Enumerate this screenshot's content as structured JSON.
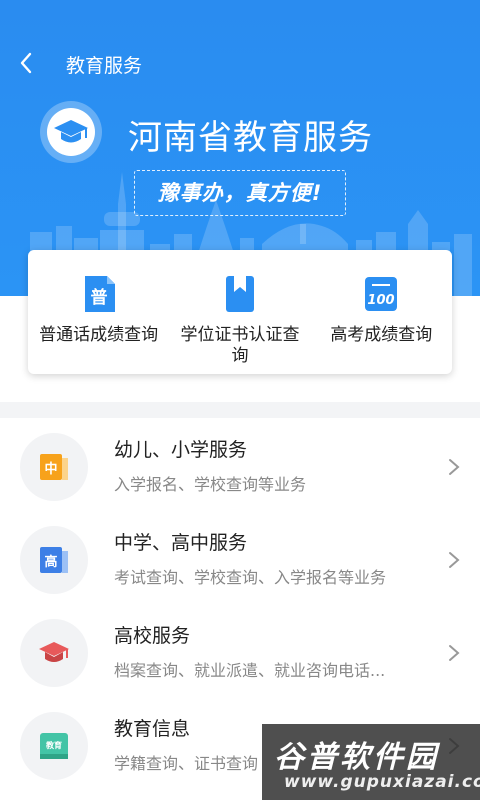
{
  "header": {
    "nav_title": "教育服务",
    "hero_title": "河南省教育服务",
    "slogan": "豫事办，真方便!"
  },
  "quick_links": [
    {
      "label": "普通话成绩查询",
      "icon": "putonghua-doc-icon",
      "icon_text": "普"
    },
    {
      "label": "学位证书认证查询",
      "icon": "bookmark-certificate-icon"
    },
    {
      "label": "高考成绩查询",
      "icon": "score-100-icon",
      "icon_text": "100"
    }
  ],
  "services": [
    {
      "title": "幼儿、小学服务",
      "subtitle": "入学报名、学校查询等业务",
      "icon": "primary-school-icon",
      "icon_text": "中"
    },
    {
      "title": "中学、高中服务",
      "subtitle": "考试查询、学校查询、入学报名等业务",
      "icon": "high-school-icon",
      "icon_text": "高"
    },
    {
      "title": "高校服务",
      "subtitle": "档案查询、就业派遣、就业咨询电话...",
      "icon": "graduation-cap-icon"
    },
    {
      "title": "教育信息",
      "subtitle": "学籍查询、证书查询",
      "icon": "education-info-book-icon",
      "icon_text": "教育"
    }
  ],
  "watermark": {
    "line1": "谷普软件园",
    "line2": "www.gupuxiazai.com"
  },
  "colors": {
    "primary": "#2b8ff2",
    "orange": "#f7a21b",
    "blue_icon": "#3d7fe6",
    "red_cap": "#e8595a",
    "teal": "#43c4a6"
  }
}
